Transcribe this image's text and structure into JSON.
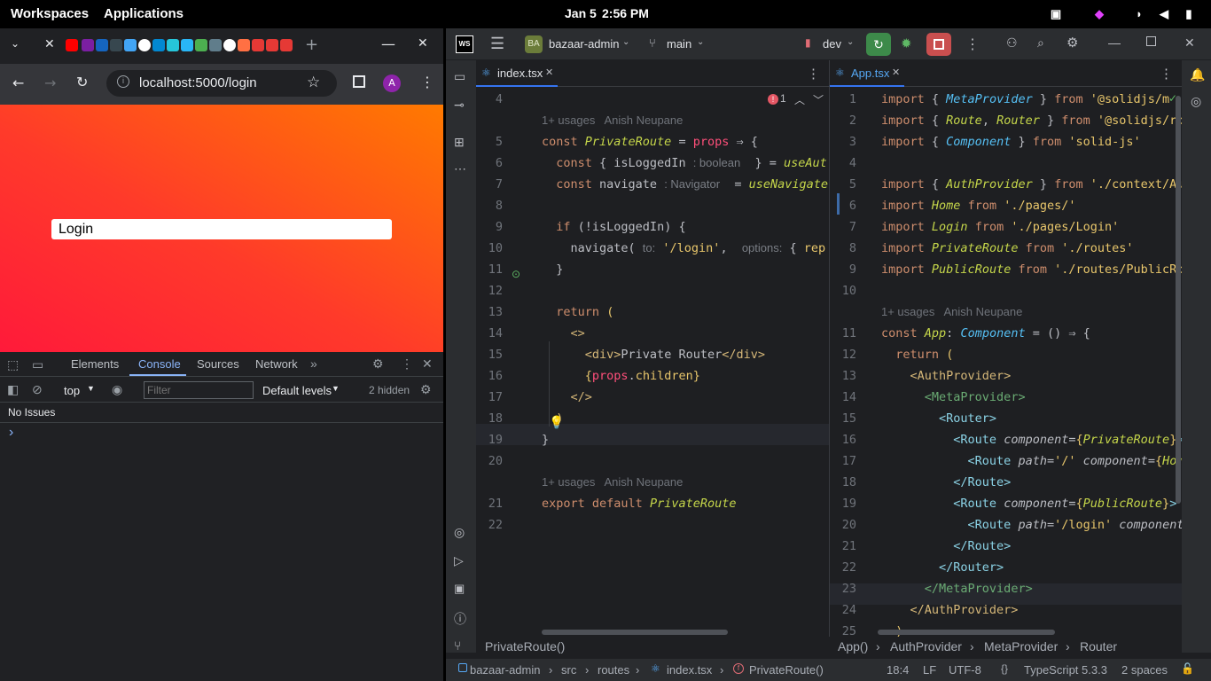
{
  "topbar": {
    "workspaces": "Workspaces",
    "applications": "Applications",
    "date": "Jan 5",
    "time": "2:56 PM"
  },
  "browser": {
    "url": "localhost:5000/login",
    "avatar_letter": "A",
    "login_value": "Login",
    "devtools": {
      "tabs": [
        "Elements",
        "Console",
        "Sources",
        "Network"
      ],
      "context": "top",
      "filter_placeholder": "Filter",
      "levels": "Default levels",
      "hidden": "2 hidden",
      "no_issues": "No Issues",
      "prompt": "›"
    }
  },
  "ide": {
    "project_badge": "BA",
    "project": "bazaar-admin",
    "branch": "main",
    "run_config": "dev",
    "left_tab": "index.tsx",
    "right_tab": "App.tsx",
    "error_count": "1",
    "left_breadcrumb": "PrivateRoute()",
    "right_breadcrumbs": [
      "App()",
      "AuthProvider",
      "MetaProvider",
      "Router"
    ],
    "status": {
      "path": [
        "bazaar-admin",
        "src",
        "routes",
        "index.tsx",
        "PrivateRoute()"
      ],
      "position": "18:4",
      "line_sep": "LF",
      "encoding": "UTF-8",
      "lang": "TypeScript 5.3.3",
      "indent": "2 spaces"
    },
    "left_code": [
      {
        "n": "4",
        "html": ""
      },
      {
        "n": "",
        "usage": "1+ usages   Anish Neupane"
      },
      {
        "n": "5",
        "html": "<span class='kw'>const</span> <span class='it'>PrivateRoute</span> = <span class='kwp'>props</span> ⇒ {"
      },
      {
        "n": "6",
        "html": "  <span class='kw'>const</span> { isLoggedIn <span class='hint'>: boolean</span>  } = <span class='it'>useAut</span>"
      },
      {
        "n": "7",
        "html": "  <span class='kw'>const</span> navigate <span class='hint'>: Navigator</span>  = <span class='it'>useNavigate</span>"
      },
      {
        "n": "8",
        "html": ""
      },
      {
        "n": "9",
        "html": "  <span class='kw'>if</span> (!isLoggedIn) {"
      },
      {
        "n": "10",
        "html": "    navigate( <span class='hint'>to:</span> <span class='str'>'/login'</span>,  <span class='hint'>options:</span> { <span class='str'>rep</span>"
      },
      {
        "n": "11",
        "html": "  }"
      },
      {
        "n": "12",
        "html": ""
      },
      {
        "n": "13",
        "html": "  <span class='kw'>return</span> <span class='str'>(</span>"
      },
      {
        "n": "14",
        "html": "    <span class='tag'>&lt;&gt;</span>"
      },
      {
        "n": "15",
        "html": "      <span class='tag'>&lt;div&gt;</span>Private Router<span class='tag'>&lt;/div&gt;</span>"
      },
      {
        "n": "16",
        "html": "      <span class='str'>{</span><span class='kwp'>props</span>.<span class='str'>children}</span>"
      },
      {
        "n": "17",
        "html": "    <span class='tag'>&lt;/&gt;</span>"
      },
      {
        "n": "18",
        "html": "  <span class='str'>)</span>"
      },
      {
        "n": "19",
        "html": "}"
      },
      {
        "n": "20",
        "html": ""
      },
      {
        "n": "",
        "usage": "1+ usages   Anish Neupane"
      },
      {
        "n": "21",
        "html": "<span class='kw'>export default</span> <span class='it'>PrivateRoute</span>"
      },
      {
        "n": "22",
        "html": ""
      }
    ],
    "right_code": [
      {
        "n": "1",
        "html": "<span class='kw'>import</span> { <span class='comp'>MetaProvider</span> } <span class='kw'>from</span> <span class='str'>'@solidjs/m</span>"
      },
      {
        "n": "2",
        "html": "<span class='kw'>import</span> { <span class='it'>Route</span>, <span class='it'>Router</span> } <span class='kw'>from</span> <span class='str'>'@solidjs/rou</span>"
      },
      {
        "n": "3",
        "html": "<span class='kw'>import</span> { <span class='comp'>Component</span> } <span class='kw'>from</span> <span class='str'>'solid-js'</span>"
      },
      {
        "n": "4",
        "html": ""
      },
      {
        "n": "5",
        "html": "<span class='kw'>import</span> { <span class='it'>AuthProvider</span> } <span class='kw'>from</span> <span class='str'>'./context/Aut</span>"
      },
      {
        "n": "6",
        "html": "<span class='kw'>import</span> <span class='it'>Home</span> <span class='kw'>from</span> <span class='str'>'./pages/'</span>"
      },
      {
        "n": "7",
        "html": "<span class='kw'>import</span> <span class='it'>Login</span> <span class='kw'>from</span> <span class='str'>'./pages/Login'</span>"
      },
      {
        "n": "8",
        "html": "<span class='kw'>import</span> <span class='it'>PrivateRoute</span> <span class='kw'>from</span> <span class='str'>'./routes'</span>"
      },
      {
        "n": "9",
        "html": "<span class='kw'>import</span> <span class='it'>PublicRoute</span> <span class='kw'>from</span> <span class='str'>'./routes/PublicRou</span>"
      },
      {
        "n": "10",
        "html": ""
      },
      {
        "n": "",
        "usage": "1+ usages   Anish Neupane"
      },
      {
        "n": "11",
        "html": "<span class='kw'>const</span> <span class='it'>App</span>: <span class='comp'>Component</span> = () ⇒ {"
      },
      {
        "n": "12",
        "html": "  <span class='kw'>return</span> <span class='str'>(</span>"
      },
      {
        "n": "13",
        "html": "    <span class='tag'>&lt;AuthProvider&gt;</span>"
      },
      {
        "n": "14",
        "html": "      <span class='cmp'>&lt;MetaProvider&gt;</span>"
      },
      {
        "n": "15",
        "html": "        <span class='ptag'>&lt;Router&gt;</span>"
      },
      {
        "n": "16",
        "html": "          <span class='ptag'>&lt;Route</span> <span class='attr'>component</span>=<span class='str'>{</span><span class='it'>PrivateRoute</span><span class='str'>}</span><span class='ptag'>&gt;</span>"
      },
      {
        "n": "17",
        "html": "            <span class='ptag'>&lt;Route</span> <span class='attr'>path</span>=<span class='str'>'/'</span> <span class='attr'>component</span>=<span class='str'>{</span><span class='it'>Home</span>"
      },
      {
        "n": "18",
        "html": "          <span class='ptag'>&lt;/Route&gt;</span>"
      },
      {
        "n": "19",
        "html": "          <span class='ptag'>&lt;Route</span> <span class='attr'>component</span>=<span class='str'>{</span><span class='it'>PublicRoute</span><span class='str'>}</span><span class='ptag'>&gt;</span>"
      },
      {
        "n": "20",
        "html": "            <span class='ptag'>&lt;Route</span> <span class='attr'>path</span>=<span class='str'>'/login'</span> <span class='attr'>component</span>="
      },
      {
        "n": "21",
        "html": "          <span class='ptag'>&lt;/Route&gt;</span>"
      },
      {
        "n": "22",
        "html": "        <span class='ptag'>&lt;/Router&gt;</span>"
      },
      {
        "n": "23",
        "html": "      <span class='cmp'>&lt;/MetaProvider&gt;</span>"
      },
      {
        "n": "24",
        "html": "    <span class='tag'>&lt;/AuthProvider&gt;</span>"
      },
      {
        "n": "25",
        "html": "  <span class='str'>)</span>"
      }
    ]
  }
}
